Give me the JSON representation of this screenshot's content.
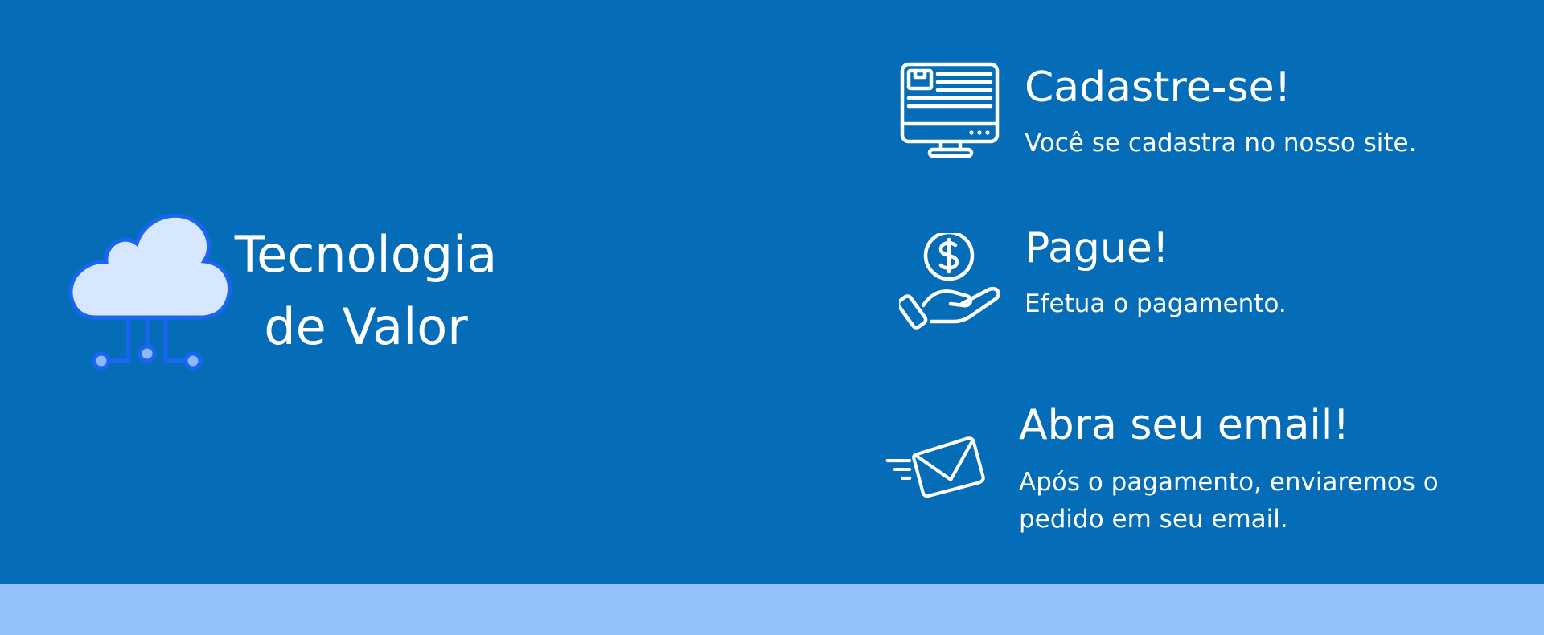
{
  "brand": {
    "line1": "Tecnologia",
    "line2": "de Valor",
    "icon": "cloud-network-icon"
  },
  "steps": [
    {
      "icon": "computer-monitor-icon",
      "title": "Cadastre-se!",
      "description": "Você se cadastra no nosso site."
    },
    {
      "icon": "hand-coin-dollar-icon",
      "title": "Pague!",
      "description": "Efetua o pagamento."
    },
    {
      "icon": "sending-envelope-icon",
      "title": "Abra seu email!",
      "description": "Após o pagamento, enviaremos o pedido em seu email."
    }
  ],
  "colors": {
    "background": "#056cb8",
    "footer_band": "#94c1fb",
    "text": "#ffffff",
    "cloud_fill": "#d6e7ff",
    "cloud_stroke": "#1a66f0"
  }
}
